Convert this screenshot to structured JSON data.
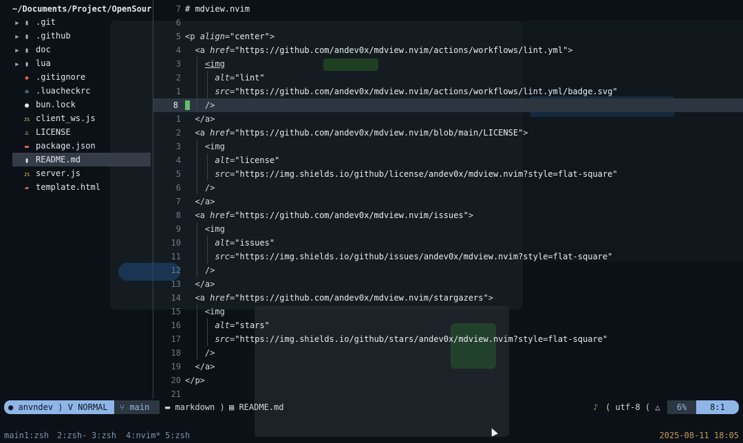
{
  "colors": {
    "accent": "#8fb6e8",
    "cursor": "#5fbf6a",
    "clock": "#c49a5a"
  },
  "tree": {
    "title": "~/Documents/Project/OpenSour",
    "items": [
      {
        "name": ".git",
        "icon": "folder-icon",
        "dir": true
      },
      {
        "name": ".github",
        "icon": "folder-icon",
        "dir": true
      },
      {
        "name": "doc",
        "icon": "folder-icon",
        "dir": true
      },
      {
        "name": "lua",
        "icon": "folder-icon",
        "dir": true
      },
      {
        "name": ".gitignore",
        "icon": "git-icon",
        "dir": false
      },
      {
        "name": ".luacheckrc",
        "icon": "gear-icon",
        "dir": false
      },
      {
        "name": "bun.lock",
        "icon": "lock-icon",
        "dir": false
      },
      {
        "name": "client_ws.js",
        "icon": "js-icon",
        "dir": false
      },
      {
        "name": "LICENSE",
        "icon": "license-icon",
        "dir": false
      },
      {
        "name": "package.json",
        "icon": "json-icon",
        "dir": false
      },
      {
        "name": "README.md",
        "icon": "markdown-icon",
        "dir": false,
        "selected": true
      },
      {
        "name": "server.js",
        "icon": "js-icon",
        "dir": false
      },
      {
        "name": "template.html",
        "icon": "html-icon",
        "dir": false
      }
    ]
  },
  "editor": {
    "lines": [
      {
        "n": "7",
        "text": "# mdview.nvim"
      },
      {
        "n": "6",
        "text": ""
      },
      {
        "n": "5",
        "text": "<p align=\"center\">"
      },
      {
        "n": "4",
        "text": "  <a href=\"https://github.com/andev0x/mdview.nvim/actions/workflows/lint.yml\">"
      },
      {
        "n": "3",
        "text": "    <img"
      },
      {
        "n": "2",
        "text": "      alt=\"lint\""
      },
      {
        "n": "1",
        "text": "      src=\"https://github.com/andev0x/mdview.nvim/actions/workflows/lint.yml/badge.svg\""
      },
      {
        "n": "8",
        "text": "    />",
        "current": true
      },
      {
        "n": "1",
        "text": "  </a>"
      },
      {
        "n": "2",
        "text": "  <a href=\"https://github.com/andev0x/mdview.nvim/blob/main/LICENSE\">"
      },
      {
        "n": "3",
        "text": "    <img"
      },
      {
        "n": "4",
        "text": "      alt=\"license\""
      },
      {
        "n": "5",
        "text": "      src=\"https://img.shields.io/github/license/andev0x/mdview.nvim?style=flat-square\""
      },
      {
        "n": "6",
        "text": "    />"
      },
      {
        "n": "7",
        "text": "  </a>"
      },
      {
        "n": "8",
        "text": "  <a href=\"https://github.com/andev0x/mdview.nvim/issues\">"
      },
      {
        "n": "9",
        "text": "    <img"
      },
      {
        "n": "10",
        "text": "      alt=\"issues\""
      },
      {
        "n": "11",
        "text": "      src=\"https://img.shields.io/github/issues/andev0x/mdview.nvim?style=flat-square\""
      },
      {
        "n": "12",
        "text": "    />"
      },
      {
        "n": "13",
        "text": "  </a>"
      },
      {
        "n": "14",
        "text": "  <a href=\"https://github.com/andev0x/mdview.nvim/stargazers\">"
      },
      {
        "n": "15",
        "text": "    <img"
      },
      {
        "n": "16",
        "text": "      alt=\"stars\""
      },
      {
        "n": "17",
        "text": "      src=\"https://img.shields.io/github/stars/andev0x/mdview.nvim?style=flat-square\""
      },
      {
        "n": "18",
        "text": "    />"
      },
      {
        "n": "19",
        "text": "  </a>"
      },
      {
        "n": "20",
        "text": "</p>"
      },
      {
        "n": "21",
        "text": ""
      }
    ]
  },
  "status": {
    "user": "anvndev",
    "mode": "NORMAL",
    "branch": "main",
    "filetype": "markdown",
    "filename": "README.md",
    "encoding": "utf-8",
    "percent": "6%",
    "position": "8:1"
  },
  "tmux": {
    "windows": [
      "main1:zsh",
      "2:zsh-",
      "3:zsh",
      "4:nvim*",
      "5:zsh"
    ],
    "clock": "2025-08-11 18:05"
  }
}
